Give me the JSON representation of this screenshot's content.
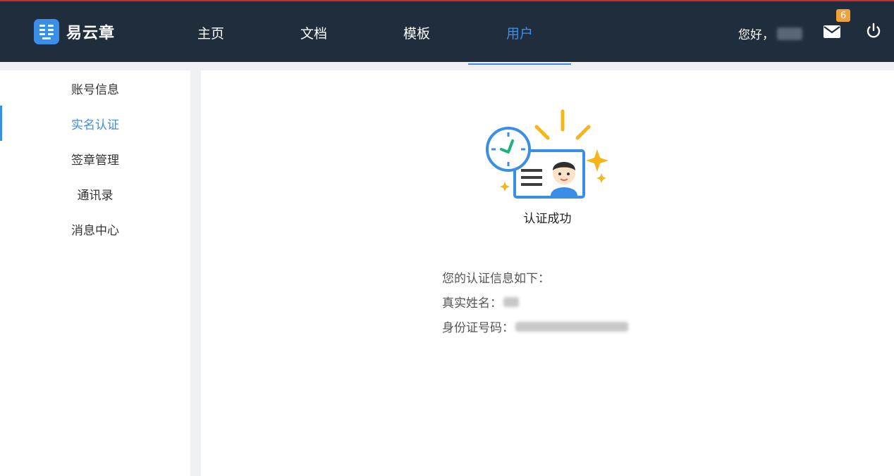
{
  "brand": {
    "name": "易云章"
  },
  "nav": {
    "items": [
      {
        "label": "主页"
      },
      {
        "label": "文档"
      },
      {
        "label": "模板"
      },
      {
        "label": "用户"
      }
    ]
  },
  "header": {
    "greeting": "您好，",
    "mail_badge": "6"
  },
  "sidebar": {
    "items": [
      {
        "label": "账号信息"
      },
      {
        "label": "实名认证"
      },
      {
        "label": "签章管理"
      },
      {
        "label": "通讯录"
      },
      {
        "label": "消息中心"
      }
    ]
  },
  "main": {
    "status": "认证成功",
    "info_title": "您的认证信息如下：",
    "name_label": "真实姓名：",
    "id_label": "身份证号码："
  },
  "colors": {
    "header_bg": "#1f2d3d",
    "accent": "#3a8ee6",
    "badge": "#f0a13a"
  }
}
